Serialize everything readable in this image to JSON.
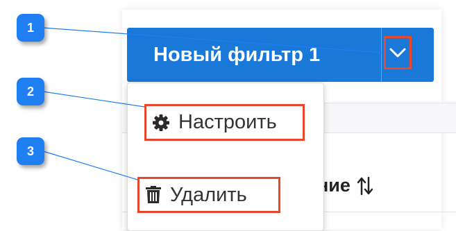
{
  "filter": {
    "label": "Новый фильтр 1"
  },
  "dropdown": {
    "items": [
      {
        "label": "Настроить",
        "icon": "gear-icon"
      },
      {
        "label": "Удалить",
        "icon": "trash-icon"
      }
    ]
  },
  "table": {
    "column_header": "исание",
    "sort_icon": "sort-arrows-icon"
  },
  "callouts": [
    "1",
    "2",
    "3"
  ],
  "colors": {
    "primary": "#1a78d9",
    "highlight": "#e9472d",
    "callout": "#1f7ff1"
  }
}
